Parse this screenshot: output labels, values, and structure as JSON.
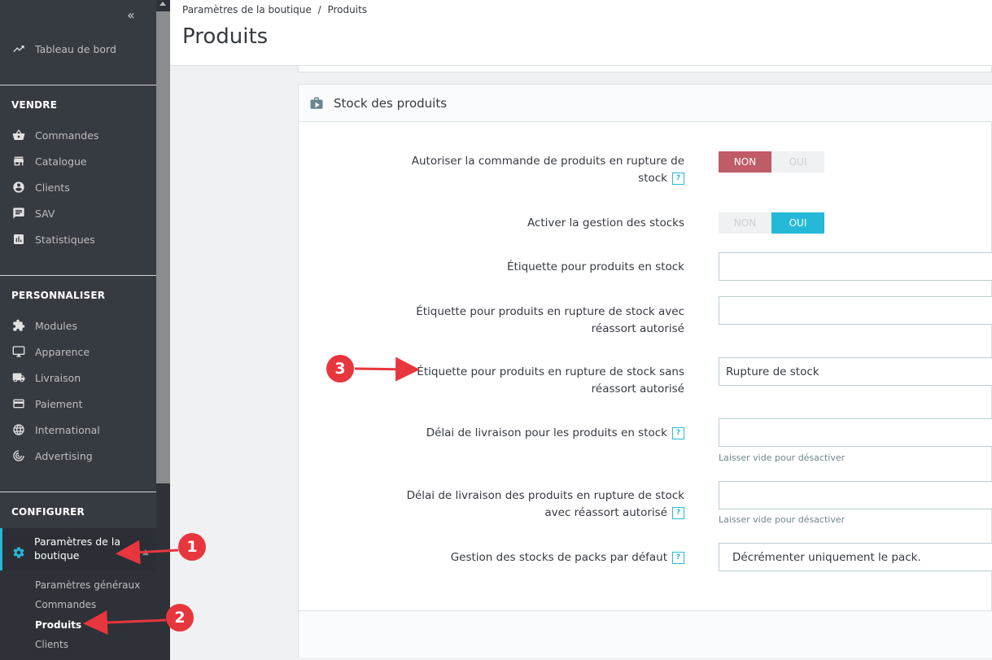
{
  "breadcrumb": {
    "parent": "Paramètres de la boutique",
    "separator": "/",
    "current": "Produits"
  },
  "page_title": "Produits",
  "sidebar": {
    "dashboard": "Tableau de bord",
    "sections": {
      "sell": "VENDRE",
      "customize": "PERSONNALISER",
      "configure": "CONFIGURER"
    },
    "sell_items": [
      "Commandes",
      "Catalogue",
      "Clients",
      "SAV",
      "Statistiques"
    ],
    "customize_items": [
      "Modules",
      "Apparence",
      "Livraison",
      "Paiement",
      "International",
      "Advertising"
    ],
    "configure_active": "Paramètres de la boutique",
    "configure_submenu": [
      "Paramètres généraux",
      "Commandes",
      "Produits",
      "Clients"
    ]
  },
  "panel": {
    "title": "Stock des produits",
    "rows": {
      "allow_oos_label": "Autoriser la commande de produits en rupture de stock",
      "allow_oos_no": "NON",
      "allow_oos_yes": "OUI",
      "stock_mgmt_label": "Activer la gestion des stocks",
      "stock_mgmt_no": "NON",
      "stock_mgmt_yes": "OUI",
      "in_stock_label": "Étiquette pour produits en stock",
      "in_stock_value": "",
      "oos_allowed_label": "Étiquette pour produits en rupture de stock avec réassort autorisé",
      "oos_allowed_value": "",
      "oos_denied_label": "Étiquette pour produits en rupture de stock sans réassort autorisé",
      "oos_denied_value": "Rupture de stock",
      "delivery_in_stock_label": "Délai de livraison pour les produits en stock",
      "delivery_in_stock_value": "",
      "delivery_in_stock_hint": "Laisser vide pour désactiver",
      "delivery_oos_label": "Délai de livraison des produits en rupture de stock avec réassort autorisé",
      "delivery_oos_value": "",
      "delivery_oos_hint": "Laisser vide pour désactiver",
      "pack_stock_label": "Gestion des stocks de packs par défaut",
      "pack_stock_value": "Décrémenter uniquement le pack."
    },
    "help_glyph": "?"
  },
  "annotations": [
    "1",
    "2",
    "3"
  ],
  "colors": {
    "accent": "#25b9d7",
    "toggle_red": "#c05c67",
    "annotation": "#e8363e",
    "sidebar_bg": "#363a41"
  }
}
